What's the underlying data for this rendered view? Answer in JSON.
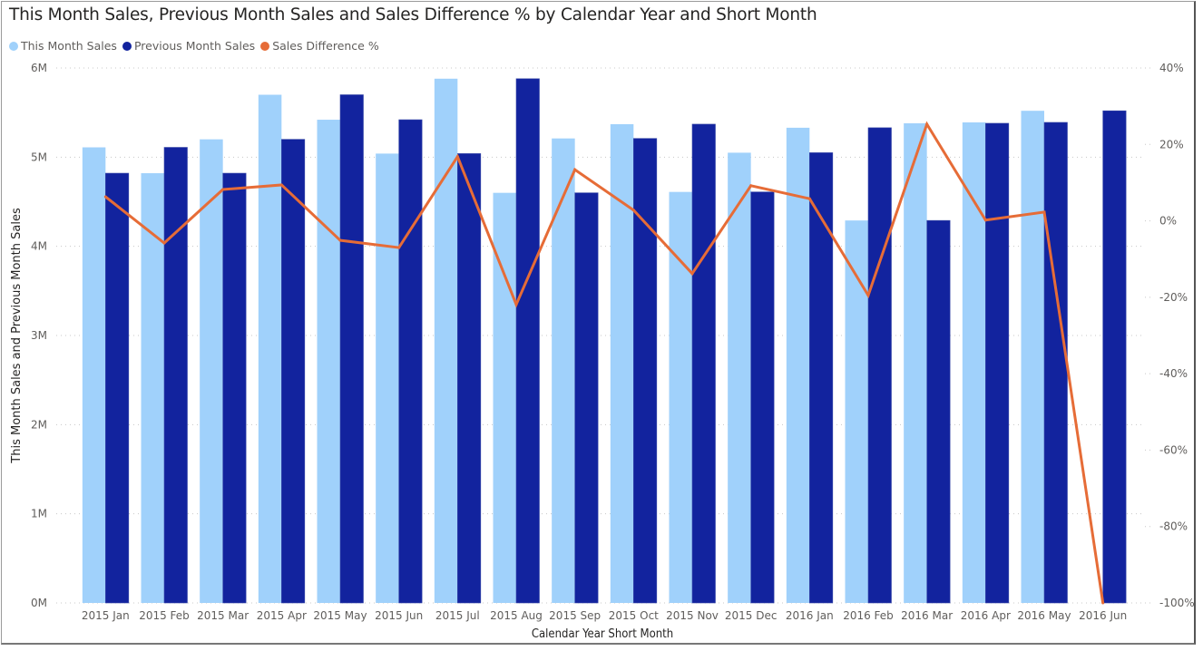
{
  "chart_data": {
    "type": "bar",
    "title": "This Month Sales, Previous Month Sales and Sales Difference % by Calendar Year and Short Month",
    "xlabel": "Calendar Year Short Month",
    "ylabel": "This Month Sales and Previous Month Sales",
    "y2label": "",
    "ylim": [
      0,
      6000000
    ],
    "y2lim": [
      -100,
      40
    ],
    "yticks": [
      "0M",
      "1M",
      "2M",
      "3M",
      "4M",
      "5M",
      "6M"
    ],
    "y2ticks": [
      "-100%",
      "-80%",
      "-60%",
      "-40%",
      "-20%",
      "0%",
      "20%",
      "40%"
    ],
    "grid": true,
    "legend_position": "top-left",
    "categories": [
      "2015 Jan",
      "2015 Feb",
      "2015 Mar",
      "2015 Apr",
      "2015 May",
      "2015 Jun",
      "2015 Jul",
      "2015 Aug",
      "2015 Sep",
      "2015 Oct",
      "2015 Nov",
      "2015 Dec",
      "2016 Jan",
      "2016 Feb",
      "2016 Mar",
      "2016 Apr",
      "2016 May",
      "2016 Jun"
    ],
    "series": [
      {
        "name": "This Month Sales",
        "type": "bar",
        "axis": "left",
        "color": "#a0d1fb",
        "values": [
          5110000,
          4820000,
          5200000,
          5700000,
          5420000,
          5040000,
          5880000,
          4600000,
          5210000,
          5370000,
          4610000,
          5050000,
          5330000,
          4290000,
          5380000,
          5390000,
          5520000,
          0
        ]
      },
      {
        "name": "Previous Month Sales",
        "type": "bar",
        "axis": "left",
        "color": "#12239e",
        "values": [
          4820000,
          5110000,
          4820000,
          5200000,
          5700000,
          5420000,
          5040000,
          5880000,
          4600000,
          5210000,
          5370000,
          4610000,
          5050000,
          5330000,
          4290000,
          5380000,
          5390000,
          5520000
        ]
      },
      {
        "name": "Sales Difference %",
        "type": "line",
        "axis": "right",
        "color": "#e66c37",
        "values": [
          6.3,
          -5.8,
          8.2,
          9.4,
          -5.1,
          -7.0,
          16.8,
          -21.9,
          13.4,
          2.8,
          -13.8,
          9.2,
          5.8,
          -19.5,
          25.3,
          0.2,
          2.3,
          -100
        ]
      }
    ]
  }
}
